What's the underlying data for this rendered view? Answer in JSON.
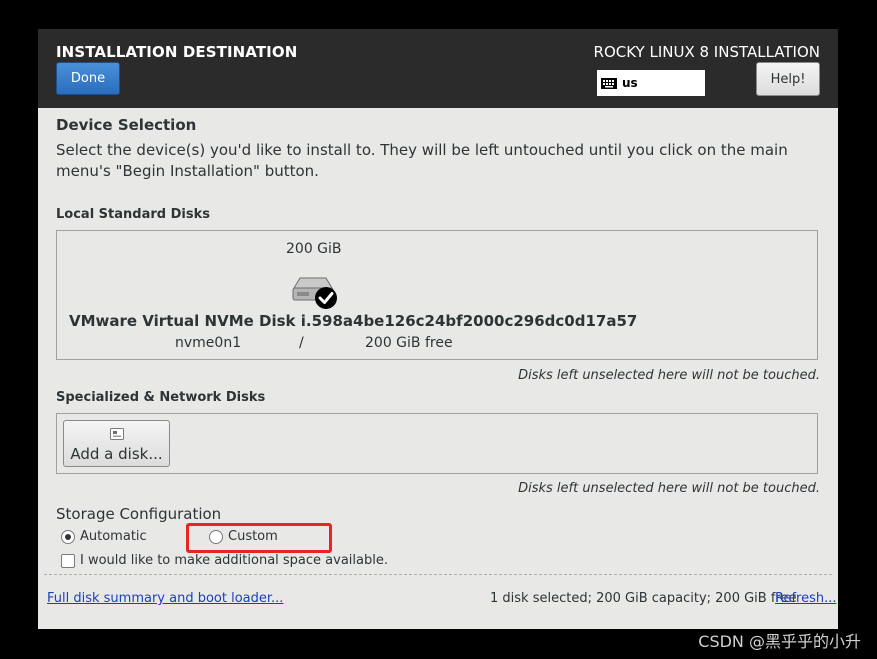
{
  "header": {
    "title": "INSTALLATION DESTINATION",
    "product": "ROCKY LINUX 8 INSTALLATION",
    "done_label": "Done",
    "keyboard_layout": "us",
    "help_label": "Help!"
  },
  "device_selection": {
    "title": "Device Selection",
    "description": "Select the device(s) you'd like to install to.  They will be left untouched until you click on the main menu's \"Begin Installation\" button."
  },
  "local_disks": {
    "title": "Local Standard Disks",
    "disks": [
      {
        "size": "200 GiB",
        "name": "VMware Virtual NVMe Disk i.598a4be126c24bf2000c296dc0d17a57",
        "device": "nvme0n1",
        "mount": "/",
        "free": "200 GiB free",
        "selected": true
      }
    ],
    "note": "Disks left unselected here will not be touched."
  },
  "specialized_disks": {
    "title": "Specialized & Network Disks",
    "add_label": "Add a disk...",
    "note": "Disks left unselected here will not be touched."
  },
  "storage": {
    "title": "Storage Configuration",
    "automatic_label": "Automatic",
    "custom_label": "Custom",
    "selected": "Automatic",
    "reclaim_label": "I would like to make additional space available.",
    "reclaim_checked": false
  },
  "footer": {
    "summary_link": "Full disk summary and boot loader...",
    "summary": "1 disk selected; 200 GiB capacity; 200 GiB free",
    "refresh_link": "Refresh..."
  },
  "watermark": "CSDN @黑乎乎的小升",
  "colors": {
    "header_bg": "#2b2b2b",
    "done_button": "#2a6dbd",
    "highlight_box": "#e8251f",
    "link": "#1a3fbf"
  }
}
